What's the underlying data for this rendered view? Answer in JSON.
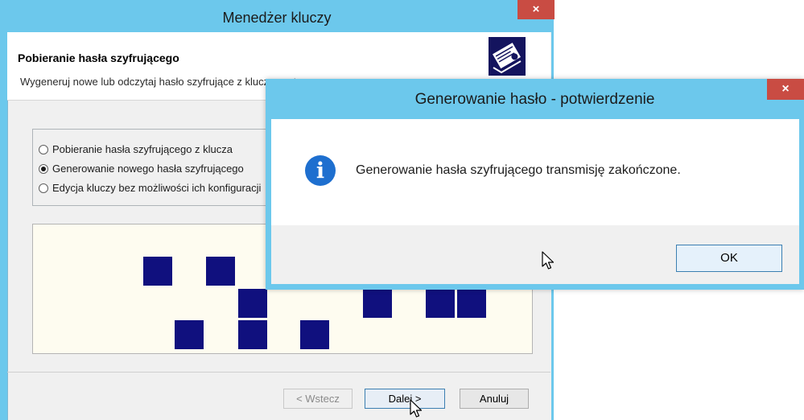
{
  "main_window": {
    "title": "Menedżer kluczy",
    "close_label": "×",
    "header": {
      "title": "Pobieranie hasła szyfrującego",
      "description": "Wygeneruj nowe lub odczytaj hasło szyfrujące z klucza systemowego"
    },
    "options": [
      {
        "label": "Pobieranie hasła szyfrującego z klucza",
        "checked": false
      },
      {
        "label": "Generowanie nowego hasła szyfrującego",
        "checked": true
      },
      {
        "label": "Edycja kluczy bez możliwości ich konfiguracji",
        "checked": false
      }
    ],
    "buttons": {
      "back": "< Wstecz",
      "next": "Dalej >",
      "cancel": "Anuluj"
    }
  },
  "dialog": {
    "title": "Generowanie hasło - potwierdzenie",
    "close_label": "×",
    "message": "Generowanie hasła szyfrującego transmisję zakończone.",
    "info_glyph": "i",
    "ok_label": "OK"
  },
  "icons": {
    "info": "info-icon",
    "logo": "certificate-icon",
    "cursor": "mouse-pointer-icon"
  },
  "colors": {
    "title_bar": "#6cc8ec",
    "close_button": "#c94c43",
    "pattern_square": "#10107e",
    "info_icon": "#1e6fcf"
  }
}
